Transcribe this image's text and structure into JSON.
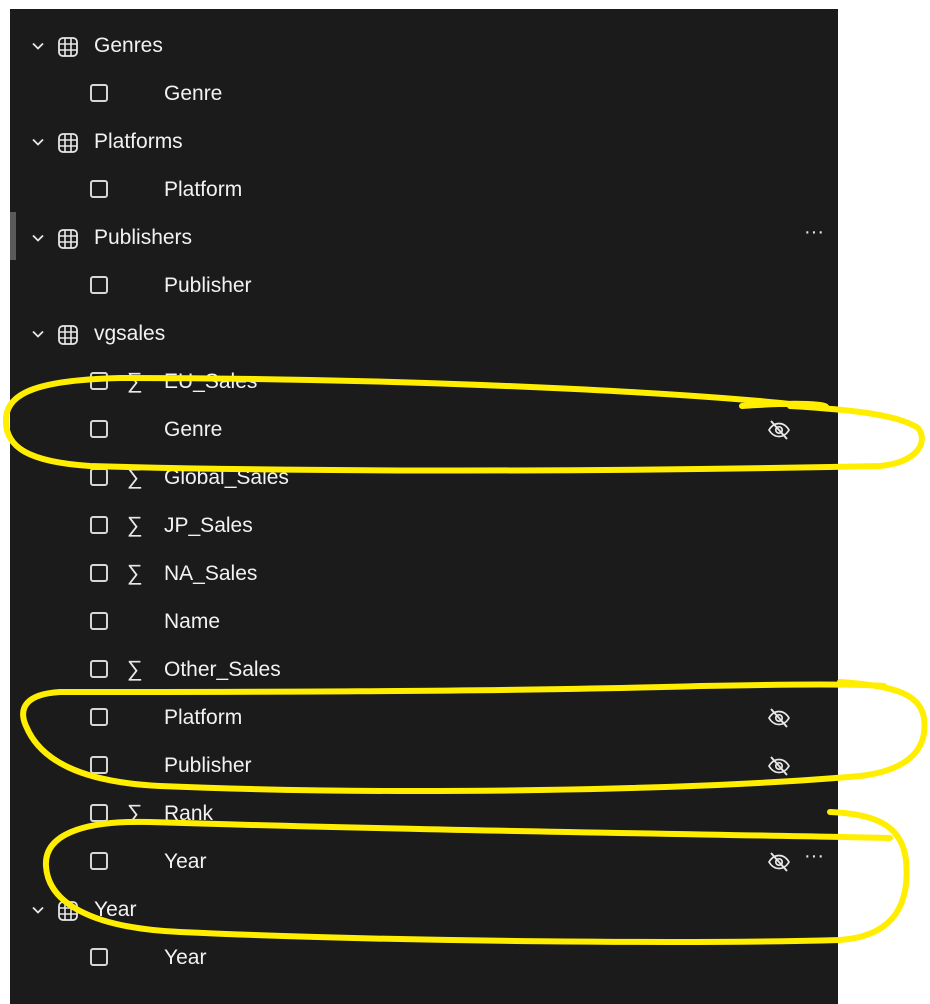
{
  "tables": [
    {
      "name": "Genres",
      "fields": [
        {
          "label": "Genre",
          "sigma": false,
          "hidden": false
        }
      ]
    },
    {
      "name": "Platforms",
      "fields": [
        {
          "label": "Platform",
          "sigma": false,
          "hidden": false
        }
      ]
    },
    {
      "name": "Publishers",
      "more_menu": "···",
      "fields": [
        {
          "label": "Publisher",
          "sigma": false,
          "hidden": false
        }
      ]
    },
    {
      "name": "vgsales",
      "fields": [
        {
          "label": "EU_Sales",
          "sigma": true,
          "hidden": false
        },
        {
          "label": "Genre",
          "sigma": false,
          "hidden": true
        },
        {
          "label": "Global_Sales",
          "sigma": true,
          "hidden": false
        },
        {
          "label": "JP_Sales",
          "sigma": true,
          "hidden": false
        },
        {
          "label": "NA_Sales",
          "sigma": true,
          "hidden": false
        },
        {
          "label": "Name",
          "sigma": false,
          "hidden": false
        },
        {
          "label": "Other_Sales",
          "sigma": true,
          "hidden": false
        },
        {
          "label": "Platform",
          "sigma": false,
          "hidden": true
        },
        {
          "label": "Publisher",
          "sigma": false,
          "hidden": true
        },
        {
          "label": "Rank",
          "sigma": true,
          "hidden": false
        },
        {
          "label": "Year",
          "sigma": false,
          "hidden": true,
          "more_menu": "···"
        }
      ]
    },
    {
      "name": "Year",
      "fields": [
        {
          "label": "Year",
          "sigma": false,
          "hidden": false
        }
      ]
    }
  ],
  "symbols": {
    "sigma": "∑"
  },
  "colors": {
    "panel_bg": "#1b1b1b",
    "text": "#f2f2f2",
    "annotation": "#ffee00"
  },
  "icons": {
    "expand": "chevron-down-icon",
    "table": "table-icon",
    "hidden": "eye-off-icon",
    "more": "more-options-icon"
  }
}
